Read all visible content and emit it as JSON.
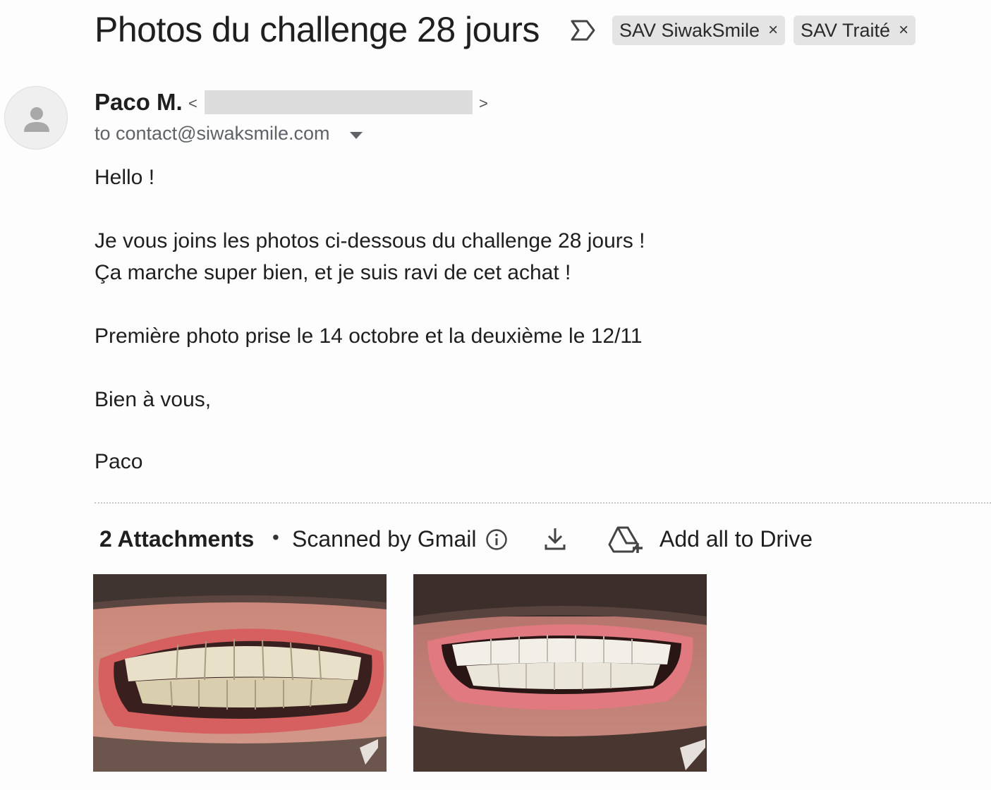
{
  "email": {
    "subject": "Photos du challenge 28 jours",
    "labels": [
      {
        "name": "SAV SiwakSmile",
        "remove": "×"
      },
      {
        "name": "SAV Traité",
        "remove": "×"
      }
    ],
    "sender": {
      "name": "Paco M.",
      "open_bracket": "<",
      "close_bracket": ">"
    },
    "recipient": "to contact@siwaksmile.com",
    "body": [
      "Hello !",
      "Je vous joins les photos ci-dessous du challenge 28 jours !",
      "Ça marche super bien, et je suis ravi de cet achat !",
      "Première photo prise le 14 octobre et la deuxième le 12/11",
      "Bien à vous,",
      "Paco"
    ]
  },
  "attachments": {
    "count_label": "2 Attachments",
    "separator": "•",
    "scan_label": "Scanned by Gmail",
    "drive_label": "Add all to Drive",
    "items": [
      {
        "type": "image",
        "icon": "smile-photo-before"
      },
      {
        "type": "image",
        "icon": "smile-photo-after"
      }
    ]
  },
  "icons": [
    "important-marker-icon",
    "avatar-person-icon",
    "chevron-down-icon",
    "info-icon",
    "download-icon",
    "drive-add-icon"
  ]
}
